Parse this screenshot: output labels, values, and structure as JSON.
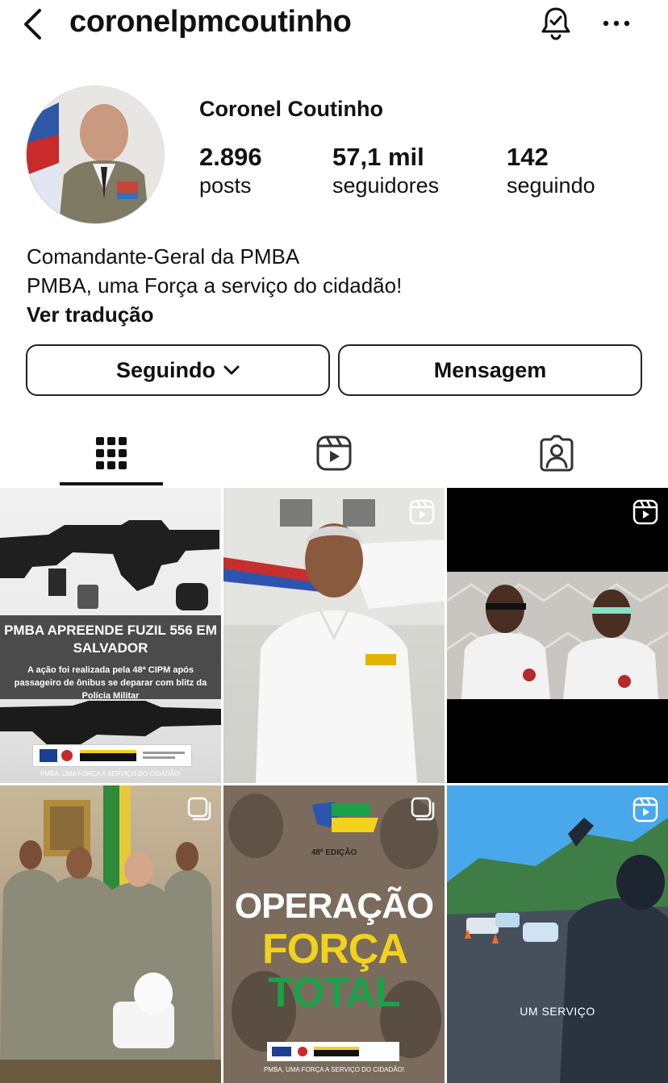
{
  "header": {
    "username": "coronelpmcoutinho",
    "back_icon": "chevron-left-icon",
    "bell_icon": "bell-check-icon",
    "more_icon": "more-horizontal-icon"
  },
  "profile": {
    "display_name": "Coronel Coutinho",
    "stats": {
      "posts": {
        "value": "2.896",
        "label": "posts"
      },
      "followers": {
        "value": "57,1 mil",
        "label": "seguidores"
      },
      "following": {
        "value": "142",
        "label": "seguindo"
      }
    },
    "bio_lines": [
      "Comandante-Geral da PMBA",
      "PMBA, uma Força a serviço do cidadão!"
    ],
    "translate_label": "Ver tradução"
  },
  "actions": {
    "following_label": "Seguindo",
    "message_label": "Mensagem"
  },
  "tabs": [
    {
      "name": "grid",
      "icon": "grid-icon",
      "active": true
    },
    {
      "name": "reels",
      "icon": "reels-icon",
      "active": false
    },
    {
      "name": "tagged",
      "icon": "tagged-person-icon",
      "active": false
    }
  ],
  "posts": {
    "p1": {
      "title": "PMBA APREENDE FUZIL 556 EM SALVADOR",
      "subtitle": "A ação foi realizada pela 48ª CIPM após passageiro de ônibus se deparar com blitz da Polícia Militar",
      "footer": "PMBA, UMA FORÇA A SERVIÇO DO CIDADÃO!"
    },
    "p2": {
      "badge": "reels-icon"
    },
    "p3": {
      "badge": "reels-icon"
    },
    "p4": {
      "badge": "multi-post-icon"
    },
    "p5": {
      "badge": "multi-post-icon",
      "tag": "FORÇA TOTAL",
      "edition": "48ª EDIÇÃO",
      "line1": "OPERAÇÃO",
      "line2_yellow": "FORÇA",
      "line2_green": "TOTAL",
      "footer": "PMBA, UMA FORÇA A SERVIÇO DO CIDADÃO!"
    },
    "p6": {
      "badge": "reels-icon",
      "caption": "UM SERVIÇO"
    }
  },
  "colors": {
    "text": "#111111",
    "border": "#222222",
    "banner": "#4b4b4b",
    "yellow": "#f2d21a",
    "green": "#19a24a"
  }
}
